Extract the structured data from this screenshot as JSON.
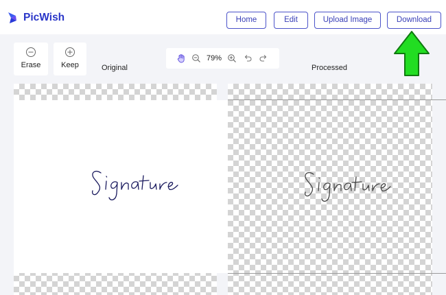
{
  "app": {
    "name": "PicWish",
    "brand_color": "#2a36c8"
  },
  "nav": {
    "home": "Home",
    "edit": "Edit",
    "upload": "Upload Image",
    "download": "Download"
  },
  "tools": {
    "erase": {
      "label": "Erase",
      "icon": "minus-circle-icon"
    },
    "keep": {
      "label": "Keep",
      "icon": "plus-circle-icon"
    }
  },
  "zoom": {
    "value": "79%"
  },
  "panes": {
    "original": "Original",
    "processed": "Processed"
  },
  "image": {
    "original_ink_color": "#1a1a5e",
    "processed_ink_color": "#444444"
  },
  "annotation": {
    "arrow_color": "#22dd22"
  }
}
